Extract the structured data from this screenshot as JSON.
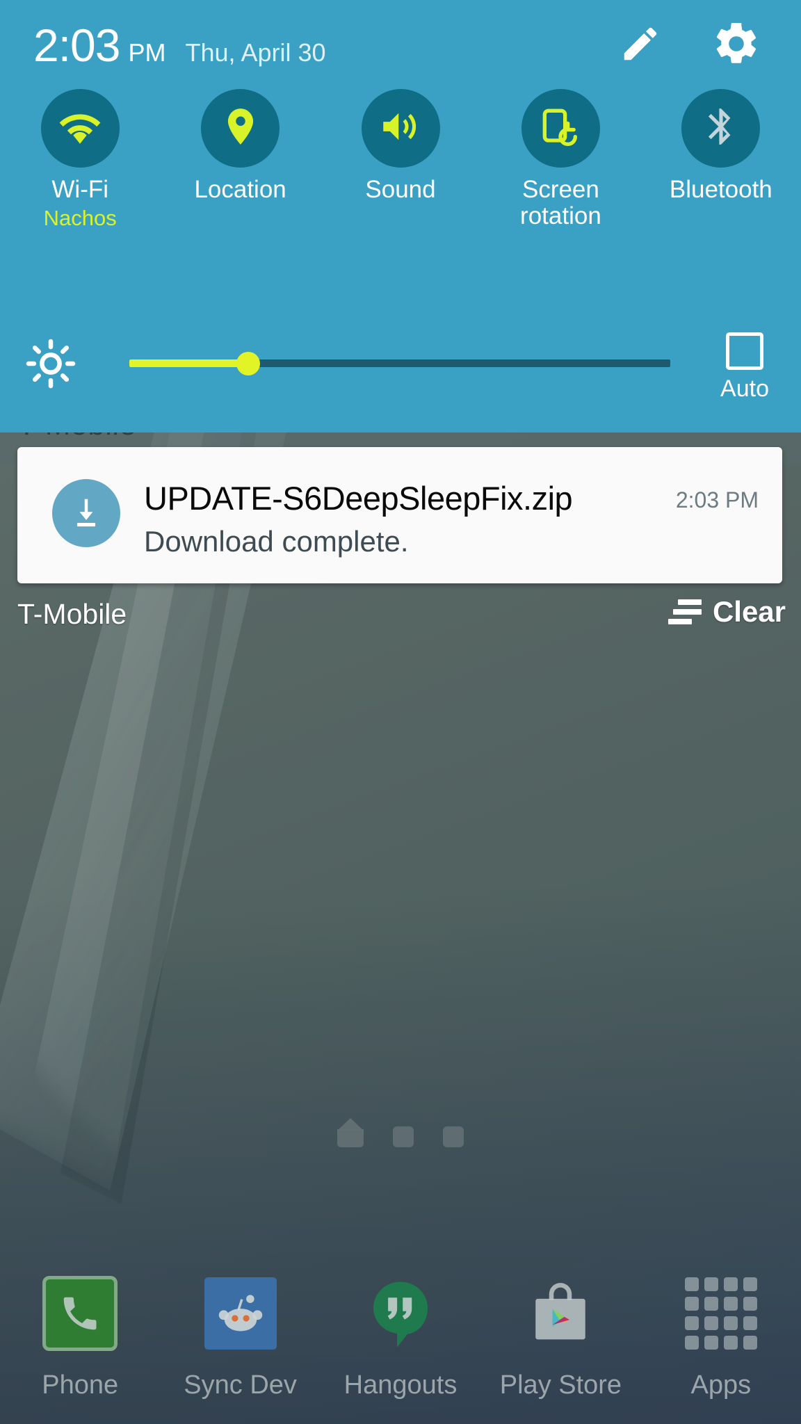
{
  "status_bar": {
    "time": "2:03",
    "ampm": "PM",
    "date": "Thu, April 30",
    "edit_icon": "pencil-icon",
    "settings_icon": "gear-icon"
  },
  "quick_settings": {
    "panel_color": "#3ba1c4",
    "active_icon_color": "#d9f32a",
    "circle_color": "#0f6d85",
    "toggles": [
      {
        "label": "Wi-Fi",
        "sublabel": "Nachos",
        "icon": "wifi-icon",
        "state": "on"
      },
      {
        "label": "Location",
        "sublabel": "",
        "icon": "location-pin-icon",
        "state": "on"
      },
      {
        "label": "Sound",
        "sublabel": "",
        "icon": "speaker-volume-icon",
        "state": "on"
      },
      {
        "label": "Screen rotation",
        "sublabel": "",
        "icon": "screen-rotation-icon",
        "state": "on"
      },
      {
        "label": "Bluetooth",
        "sublabel": "",
        "icon": "bluetooth-icon",
        "state": "off"
      }
    ],
    "brightness": {
      "icon": "brightness-sun-icon",
      "value_percent": 22,
      "auto_label": "Auto",
      "auto_checked": false
    }
  },
  "ghost_row": {
    "carrier": "T-Mobile",
    "clear": "Clear"
  },
  "notification": {
    "icon": "download-complete-icon",
    "icon_bg": "#62a8c4",
    "title": "UPDATE-S6DeepSleepFix.zip",
    "time": "2:03 PM",
    "subtitle": "Download complete."
  },
  "shade_footer": {
    "carrier": "T-Mobile",
    "clear_label": "Clear",
    "clear_icon": "clear-all-icon"
  },
  "home": {
    "page_indicators": [
      {
        "type": "home",
        "active": true
      },
      {
        "type": "dot",
        "active": false
      },
      {
        "type": "dot",
        "active": false
      }
    ],
    "dock": [
      {
        "label": "Phone",
        "icon": "phone-handset-icon"
      },
      {
        "label": "Sync Dev",
        "icon": "reddit-alien-icon"
      },
      {
        "label": "Hangouts",
        "icon": "hangouts-quote-bubble-icon"
      },
      {
        "label": "Play Store",
        "icon": "play-store-bag-icon"
      },
      {
        "label": "Apps",
        "icon": "apps-grid-icon"
      }
    ]
  }
}
